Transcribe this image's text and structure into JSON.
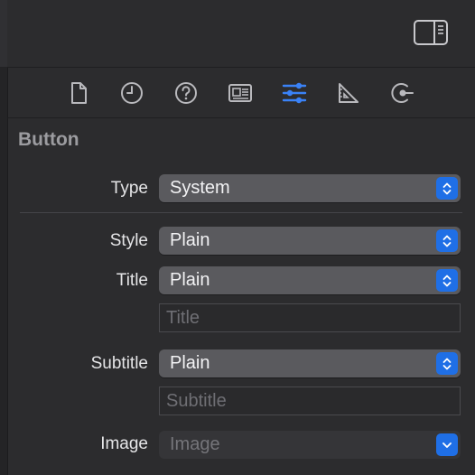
{
  "header": {
    "inspector_toggle_icon": "sidebar-right-icon"
  },
  "tabs": [
    {
      "name": "file-inspector",
      "icon": "document-icon",
      "active": false
    },
    {
      "name": "history-inspector",
      "icon": "clock-icon",
      "active": false
    },
    {
      "name": "quick-help-inspector",
      "icon": "question-mark-circle-icon",
      "active": false
    },
    {
      "name": "identity-inspector",
      "icon": "id-card-icon",
      "active": false
    },
    {
      "name": "attributes-inspector",
      "icon": "sliders-icon",
      "active": true
    },
    {
      "name": "size-inspector",
      "icon": "ruler-triangle-icon",
      "active": false
    },
    {
      "name": "connections-inspector",
      "icon": "connection-arrow-icon",
      "active": false
    }
  ],
  "section": {
    "title": "Button"
  },
  "fields": {
    "type": {
      "label": "Type",
      "value": "System"
    },
    "style": {
      "label": "Style",
      "value": "Plain"
    },
    "title": {
      "label": "Title",
      "value": "Plain"
    },
    "title_text": {
      "placeholder": "Title",
      "value": ""
    },
    "subtitle": {
      "label": "Subtitle",
      "value": "Plain"
    },
    "subtitle_text": {
      "placeholder": "Subtitle",
      "value": ""
    },
    "image": {
      "label": "Image",
      "placeholder": "Image"
    }
  },
  "colors": {
    "accent": "#3a82f7",
    "stepper": "#1f6fe6",
    "panel_bg": "#2c2c2e",
    "popup_bg": "#5a5a5e"
  }
}
